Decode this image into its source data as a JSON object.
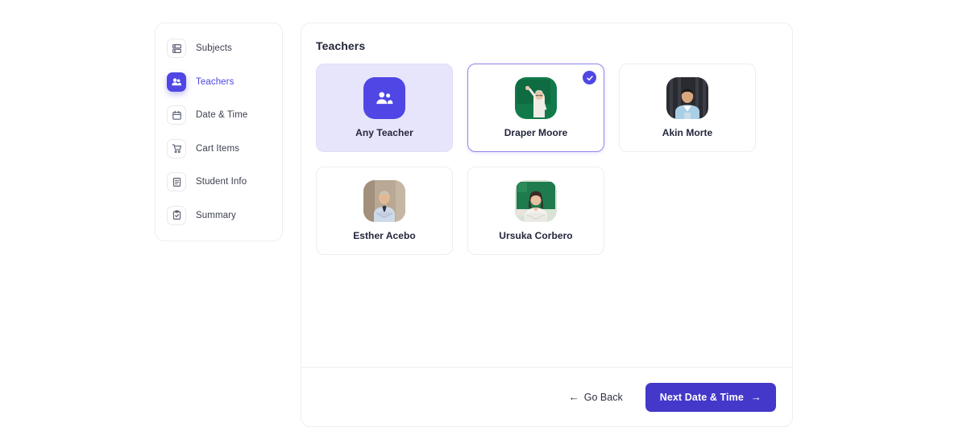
{
  "theme": {
    "accent": "#4f46e5",
    "accent_dark": "#4338ca",
    "accent_soft": "#e7e5fb",
    "border": "#eceef3",
    "text": "#23263b",
    "muted_text": "#3d4151"
  },
  "sidebar": {
    "items": [
      {
        "label": "Subjects",
        "icon": "subjects-icon",
        "active": false
      },
      {
        "label": "Teachers",
        "icon": "teachers-icon",
        "active": true
      },
      {
        "label": "Date & Time",
        "icon": "calendar-icon",
        "active": false
      },
      {
        "label": "Cart Items",
        "icon": "cart-icon",
        "active": false
      },
      {
        "label": "Student Info",
        "icon": "document-icon",
        "active": false
      },
      {
        "label": "Summary",
        "icon": "clipboard-check-icon",
        "active": false
      }
    ]
  },
  "main": {
    "title": "Teachers",
    "cards": [
      {
        "name": "Any Teacher",
        "kind": "any",
        "icon": "group-icon",
        "selected": false,
        "avatar": {
          "bg": "#4f46e5"
        }
      },
      {
        "name": "Draper Moore",
        "kind": "teacher",
        "selected": true,
        "avatar": {
          "bg": "#127a4a",
          "skin": "#e8c6a8",
          "shirt": "#f0ece6",
          "hair": "#d9d4cc"
        }
      },
      {
        "name": "Akin Morte",
        "kind": "teacher",
        "selected": false,
        "avatar": {
          "bg": "#2a2b31",
          "skin": "#d9a77e",
          "shirt": "#a9cfe6",
          "hair": "#1d1a18"
        }
      },
      {
        "name": "Esther Acebo",
        "kind": "teacher",
        "selected": false,
        "avatar": {
          "bg": "#b8a894",
          "skin": "#e2b894",
          "shirt": "#cfdae8",
          "hair": "#c9c2b6"
        }
      },
      {
        "name": "Ursuka Corbero",
        "kind": "teacher",
        "selected": false,
        "avatar": {
          "bg": "#1f7a4d",
          "skin": "#e8c0a2",
          "shirt": "#f4f2ee",
          "hair": "#3a2b23"
        }
      }
    ]
  },
  "footer": {
    "back_label": "Go Back",
    "back_arrow": "←",
    "next_label": "Next Date & Time",
    "next_arrow": "→"
  }
}
